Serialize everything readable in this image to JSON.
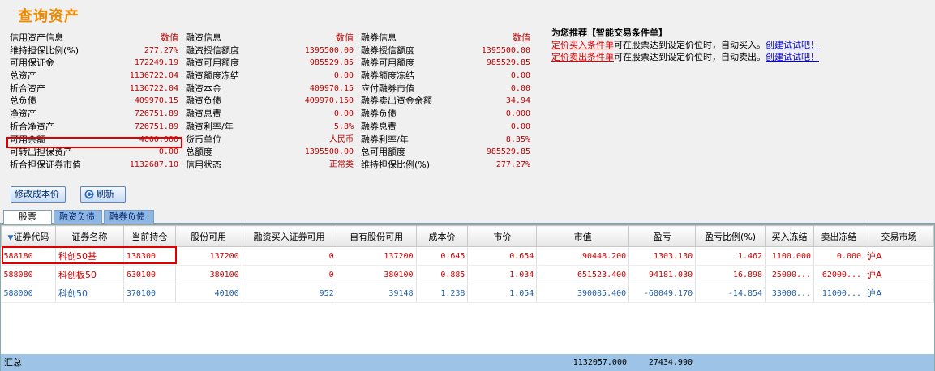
{
  "page_title": "查询资产",
  "asset_info": {
    "rows": [
      {
        "c1_label": "信用资产信息",
        "c1_value": "数值",
        "c2_label": "融资信息",
        "c2_value": "数值",
        "c3_label": "融券信息",
        "c3_value": "数值"
      },
      {
        "c1_label": "维持担保比例(%)",
        "c1_value": "277.27%",
        "c2_label": "融资授信额度",
        "c2_value": "1395500.00",
        "c3_label": "融券授信额度",
        "c3_value": "1395500.00"
      },
      {
        "c1_label": "可用保证金",
        "c1_value": "172249.19",
        "c2_label": "融资可用额度",
        "c2_value": "985529.85",
        "c3_label": "融券可用额度",
        "c3_value": "985529.85"
      },
      {
        "c1_label": "总资产",
        "c1_value": "1136722.04",
        "c2_label": "融资额度冻结",
        "c2_value": "0.00",
        "c3_label": "融券额度冻结",
        "c3_value": "0.00"
      },
      {
        "c1_label": "折合资产",
        "c1_value": "1136722.04",
        "c2_label": "融资本金",
        "c2_value": "409970.15",
        "c3_label": "应付融券市值",
        "c3_value": "0.00"
      },
      {
        "c1_label": "总负债",
        "c1_value": "409970.15",
        "c2_label": "融资负债",
        "c2_value": "409970.150",
        "c3_label": "融券卖出资金余额",
        "c3_value": "34.94"
      },
      {
        "c1_label": "净资产",
        "c1_value": "726751.89",
        "c2_label": "融资息费",
        "c2_value": "0.00",
        "c3_label": "融券负债",
        "c3_value": "0.000"
      },
      {
        "c1_label": "折合净资产",
        "c1_value": "726751.89",
        "c2_label": "融资利率/年",
        "c2_value": "5.8%",
        "c3_label": "融券息费",
        "c3_value": "0.00"
      },
      {
        "c1_label": "可用余额",
        "c1_value": "4000.000",
        "c2_label": "货币单位",
        "c2_value": "人民币",
        "c3_label": "融券利率/年",
        "c3_value": "8.35%"
      },
      {
        "c1_label": "可转出担保资产",
        "c1_value": "0.00",
        "c2_label": "总额度",
        "c2_value": "1395500.00",
        "c3_label": "总可用额度",
        "c3_value": "985529.85"
      },
      {
        "c1_label": "折合担保证券市值",
        "c1_value": "1132687.10",
        "c2_label": "信用状态",
        "c2_value": "正常类",
        "c3_label": "维持担保比例(%)",
        "c3_value": "277.27%"
      }
    ]
  },
  "recommend": {
    "title": "为您推荐【智能交易条件单】",
    "lines": [
      {
        "link": "定价买入条件单",
        "text": "可在股票达到设定价位时，自动买入。",
        "action": "创建试试吧！"
      },
      {
        "link": "定价卖出条件单",
        "text": "可在股票达到设定价位时，自动卖出。",
        "action": "创建试试吧！"
      }
    ]
  },
  "buttons": {
    "edit_cost": "修改成本价",
    "refresh": "刷新"
  },
  "tabs": [
    "股票",
    "融资负债",
    "融券负债"
  ],
  "table": {
    "columns": [
      "证券代码",
      "证券名称",
      "当前持仓",
      "股份可用",
      "融资买入证券可用",
      "自有股份可用",
      "成本价",
      "市价",
      "市值",
      "盈亏",
      "盈亏比例(%)",
      "买入冻结",
      "卖出冻结",
      "交易市场"
    ],
    "rows": [
      {
        "tone": "red",
        "cells": [
          "588180",
          "科创50基",
          "138300",
          "137200",
          "0",
          "137200",
          "0.645",
          "0.654",
          "90448.200",
          "1303.130",
          "1.462",
          "1100.000",
          "0.000",
          "沪A"
        ]
      },
      {
        "tone": "red",
        "cells": [
          "588080",
          "科创板50",
          "630100",
          "380100",
          "0",
          "380100",
          "0.885",
          "1.034",
          "651523.400",
          "94181.030",
          "16.898",
          "25000...",
          "62000...",
          "沪A"
        ]
      },
      {
        "tone": "blue",
        "cells": [
          "588000",
          "科创50",
          "370100",
          "40100",
          "952",
          "39148",
          "1.238",
          "1.054",
          "390085.400",
          "-68049.170",
          "-14.854",
          "33000...",
          "11000...",
          "沪A"
        ]
      }
    ],
    "total": {
      "label": "汇总",
      "market_value": "1132057.000",
      "profit": "27434.990"
    }
  },
  "colors": {
    "title": "#f08a00",
    "value_red": "#c00000",
    "row_blue": "#1f5fa8",
    "total_bg": "#9dc3e6",
    "highlight": "#e00000"
  }
}
